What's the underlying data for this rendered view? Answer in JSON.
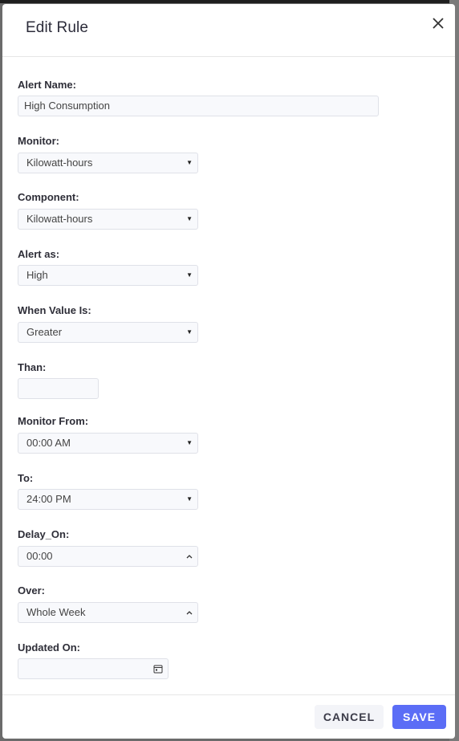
{
  "modal": {
    "title": "Edit Rule",
    "close_icon": "close-icon"
  },
  "fields": {
    "alert_name": {
      "label": "Alert Name:",
      "value": "High Consumption"
    },
    "monitor": {
      "label": "Monitor:",
      "value": "Kilowatt-hours"
    },
    "component": {
      "label": "Component:",
      "value": "Kilowatt-hours"
    },
    "alert_as": {
      "label": "Alert as:",
      "value": "High"
    },
    "when_value_is": {
      "label": "When Value Is:",
      "value": "Greater"
    },
    "than": {
      "label": "Than:",
      "value": ""
    },
    "monitor_from": {
      "label": "Monitor From:",
      "value": "00:00 AM"
    },
    "to": {
      "label": "To:",
      "value": "24:00 PM"
    },
    "delay_on": {
      "label": "Delay_On:",
      "value": "00:00"
    },
    "over": {
      "label": "Over:",
      "value": "Whole Week"
    },
    "updated_on": {
      "label": "Updated On:",
      "value": ""
    }
  },
  "footer": {
    "cancel_label": "CANCEL",
    "save_label": "SAVE"
  },
  "colors": {
    "accent": "#5b6df6",
    "cancel_bg": "#f3f4f8"
  }
}
